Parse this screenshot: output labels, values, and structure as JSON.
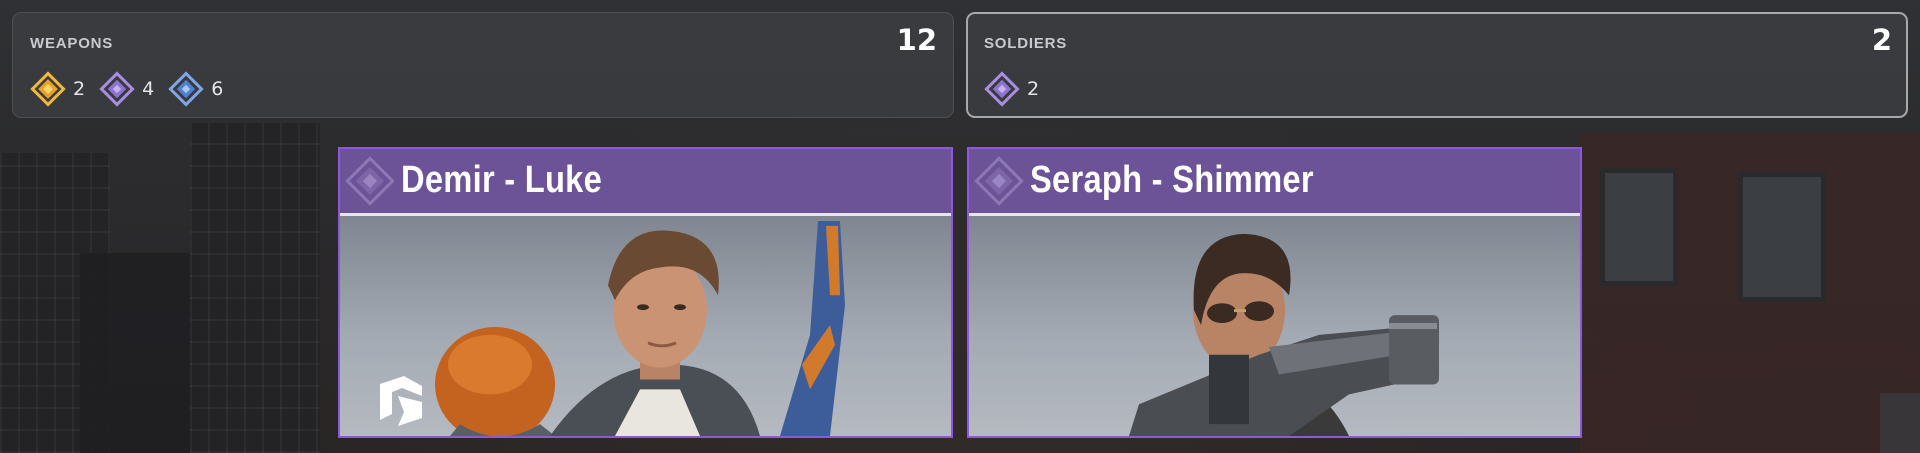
{
  "stats": {
    "weapons": {
      "label": "WEAPONS",
      "total": "12",
      "rarities": [
        {
          "icon": "legendary-rarity-icon",
          "color": "#f1b83a",
          "count": "2"
        },
        {
          "icon": "epic-rarity-icon",
          "color": "#a98ee0",
          "count": "4"
        },
        {
          "icon": "rare-rarity-icon",
          "color": "#7fa6e6",
          "count": "6"
        }
      ]
    },
    "soldiers": {
      "label": "SOLDIERS",
      "total": "2",
      "rarities": [
        {
          "icon": "epic-rarity-icon",
          "color": "#a98ee0",
          "count": "2"
        }
      ]
    }
  },
  "cards": [
    {
      "title": "Demir - Luke",
      "rarity_icon": "epic-rarity-icon",
      "header_color": "#6c5296",
      "border_color": "#8e58d8",
      "brand_icon": "brand-logo-icon"
    },
    {
      "title": "Seraph - Shimmer",
      "rarity_icon": "epic-rarity-icon",
      "header_color": "#6c5296",
      "border_color": "#8e58d8"
    }
  ]
}
